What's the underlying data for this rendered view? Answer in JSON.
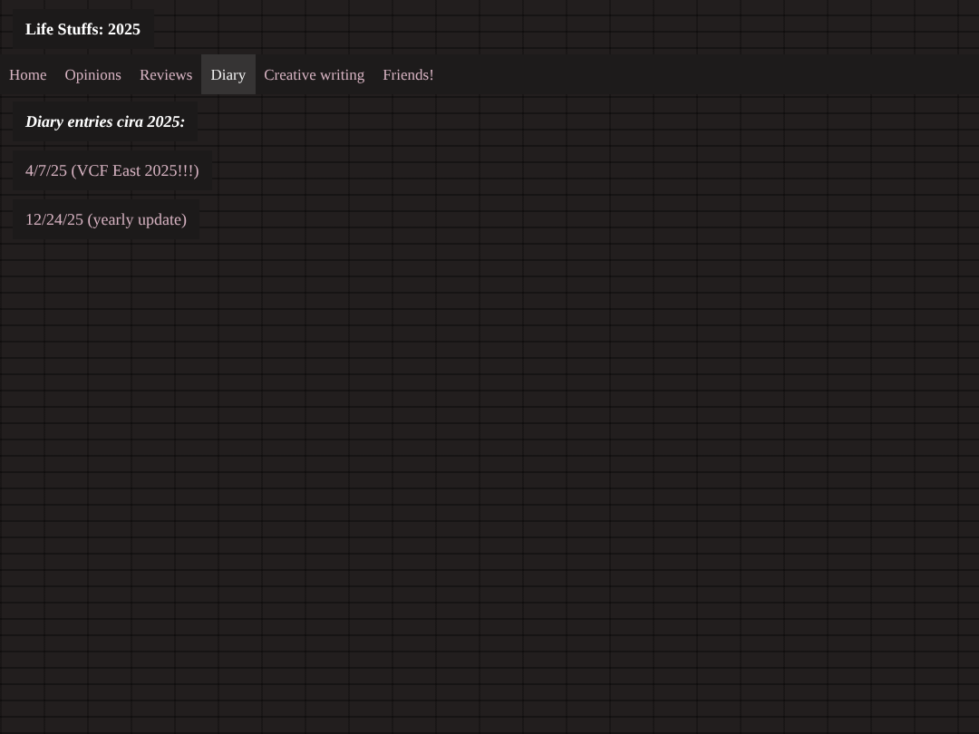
{
  "site_title": "Life Stuffs: 2025",
  "nav": [
    {
      "label": "Home",
      "selected": false
    },
    {
      "label": "Opinions",
      "selected": false
    },
    {
      "label": "Reviews",
      "selected": false
    },
    {
      "label": "Diary",
      "selected": true
    },
    {
      "label": "Creative writing",
      "selected": false
    },
    {
      "label": "Friends!",
      "selected": false
    }
  ],
  "heading": "Diary entries cira 2025:",
  "entries": [
    "4/7/25 (VCF East 2025!!!)",
    "12/24/25 (yearly update)"
  ]
}
